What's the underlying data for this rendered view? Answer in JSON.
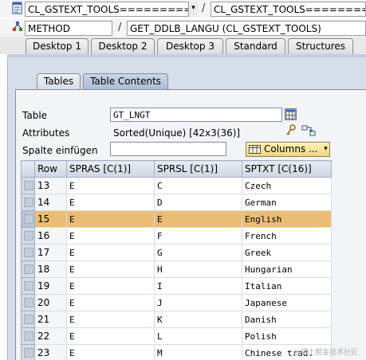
{
  "context": {
    "class_name": "CL_GSTEXT_TOOLS============",
    "separator": "/",
    "class_name_2": "CL_GSTEXT_TOOLS===================",
    "method_label": "METHOD",
    "method_name": "GET_DDLB_LANGU (CL_GSTEXT_TOOLS)"
  },
  "top_tabs": [
    "Desktop 1",
    "Desktop 2",
    "Desktop 3",
    "Standard",
    "Structures"
  ],
  "inner_tabs": [
    "Tables",
    "Table Contents"
  ],
  "form": {
    "table_label": "Table",
    "table_value": "GT_LNGT",
    "attributes_label": "Attributes",
    "attributes_value": "Sorted(Unique) [42x3(36)]",
    "insert_column_label": "Spalte einfügen",
    "insert_column_value": "",
    "columns_button": "Columns ..."
  },
  "table": {
    "columns": [
      "Row",
      "SPRAS [C(1)]",
      "SPRSL [C(1)]",
      "SPTXT [C(16)]"
    ],
    "rows": [
      {
        "row": "13",
        "spras": "E",
        "sprsl": "C",
        "sptxt": "Czech"
      },
      {
        "row": "14",
        "spras": "E",
        "sprsl": "D",
        "sptxt": "German"
      },
      {
        "row": "15",
        "spras": "E",
        "sprsl": "E",
        "sptxt": "English"
      },
      {
        "row": "16",
        "spras": "E",
        "sprsl": "F",
        "sptxt": "French"
      },
      {
        "row": "17",
        "spras": "E",
        "sprsl": "G",
        "sptxt": "Greek"
      },
      {
        "row": "18",
        "spras": "E",
        "sprsl": "H",
        "sptxt": "Hungarian"
      },
      {
        "row": "19",
        "spras": "E",
        "sprsl": "I",
        "sptxt": "Italian"
      },
      {
        "row": "20",
        "spras": "E",
        "sprsl": "J",
        "sptxt": "Japanese"
      },
      {
        "row": "21",
        "spras": "E",
        "sprsl": "K",
        "sptxt": "Danish"
      },
      {
        "row": "22",
        "spras": "E",
        "sprsl": "L",
        "sptxt": "Polish"
      },
      {
        "row": "23",
        "spras": "E",
        "sprsl": "M",
        "sptxt": "Chinese trad."
      }
    ],
    "highlighted_row": "15"
  },
  "watermark": "@稀土掘金技术社区",
  "icons": [
    "document-icon",
    "method-icon",
    "table-icon",
    "key-icon",
    "transfer-icon",
    "columns-icon",
    "dropdown-icon"
  ],
  "colors": {
    "highlight_row": "#e9be74",
    "panel_bg": "#d6deea",
    "columns_button": "#f0d680"
  }
}
